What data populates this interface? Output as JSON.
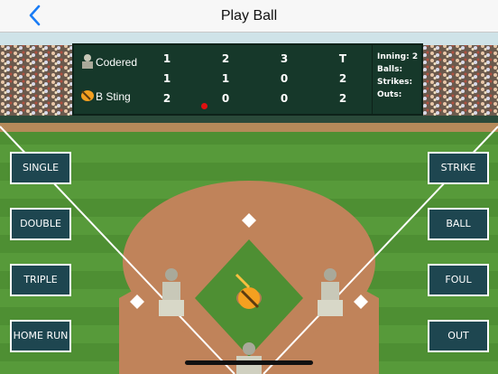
{
  "nav": {
    "title": "Play Ball"
  },
  "scoreboard": {
    "innings": [
      "1",
      "2",
      "3",
      "T"
    ],
    "teams": [
      {
        "name": "Codered",
        "scores": [
          "1",
          "1",
          "0",
          "2"
        ]
      },
      {
        "name": "B Sting",
        "scores": [
          "2",
          "0",
          "0",
          "2"
        ]
      }
    ],
    "inning_label": "Inning: 2",
    "balls_label": "Balls:",
    "strikes_label": "Strikes:",
    "outs_label": "Outs:"
  },
  "hit_buttons": [
    "SINGLE",
    "DOUBLE",
    "TRIPLE",
    "HOME RUN"
  ],
  "call_buttons": [
    "STRIKE",
    "BALL",
    "FOUL",
    "OUT"
  ],
  "colors": {
    "board": "#16382a",
    "button": "#1e4650",
    "dirt": "#c0835a",
    "grass": "#4a8a2e",
    "indicator": "#e01010"
  }
}
